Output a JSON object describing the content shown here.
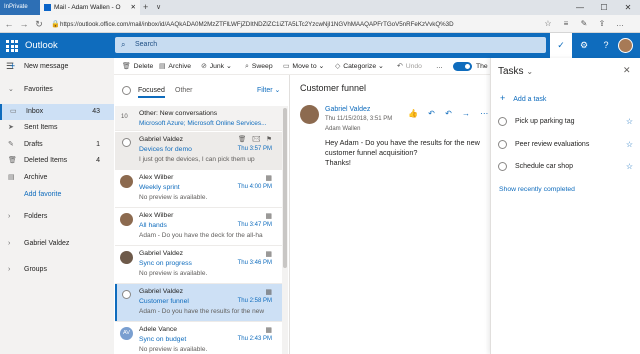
{
  "browser": {
    "inprivate_label": "InPrivate",
    "tab_title": "Mail - Adam Wallen - O",
    "tab_close": "✕",
    "new_tab": "+",
    "tab_chevron": "∨",
    "url": "https://outlook.office.com/mail/inbox/id/AAQkADA0M2MzZTFlLWFjZDItNDZlZC1iZTA5LTc2YzcwNjI1NGVhMAAQAPFrTGoV5nRFeKzVvkQ%3D",
    "back": "←",
    "forward": "→",
    "refresh": "↻",
    "lock": "🔒",
    "toolbar_icons": [
      "☆",
      "≡",
      "✎",
      "⇪",
      "…"
    ],
    "win_min": "—",
    "win_max": "☐",
    "win_close": "✕"
  },
  "header": {
    "brand": "Outlook",
    "search_placeholder": "Search",
    "search_icon": "⌕",
    "icons": {
      "tasks": "✓",
      "settings": "⚙",
      "help": "?"
    }
  },
  "leftnav": {
    "hamburger": "☰",
    "new_message": "New message",
    "favorites": "Favorites",
    "folders": [
      {
        "label": "Inbox",
        "count": "43",
        "icon": "▭"
      },
      {
        "label": "Sent Items",
        "count": "",
        "icon": "➤"
      },
      {
        "label": "Drafts",
        "count": "1",
        "icon": "✎"
      },
      {
        "label": "Deleted Items",
        "count": "4",
        "icon": "🗑"
      },
      {
        "label": "Archive",
        "count": "",
        "icon": "▤"
      }
    ],
    "add_favorite": "Add favorite",
    "sections": [
      "Folders",
      "Gabriel Valdez",
      "Groups"
    ],
    "chevron": "›",
    "chevron_down": "⌄"
  },
  "commandbar": {
    "delete": "Delete",
    "archive": "Archive",
    "junk": "Junk",
    "sweep": "Sweep",
    "move_to": "Move to",
    "categorize": "Categorize",
    "undo": "Undo",
    "more": "…",
    "toggle_label": "The",
    "icons": {
      "delete": "🗑",
      "archive": "▤",
      "junk": "⊘",
      "sweep": "⌕",
      "move": "▭",
      "categorize": "◇",
      "undo": "↶",
      "dropdown": "⌄"
    }
  },
  "messagelist": {
    "tabs": {
      "focused": "Focused",
      "other": "Other"
    },
    "filter": "Filter",
    "filter_icon": "⌄",
    "other_box": {
      "count": "10",
      "title": "Other: New conversations",
      "senders": "Microsoft Azure; Microsoft Online Services..."
    },
    "mails": [
      {
        "sender": "Gabriel Valdez",
        "subject": "Devices for demo",
        "time": "Thu 3:57 PM",
        "preview": "I just got the devices, I can pick them up",
        "actions": "🗑 ✉ ⚑"
      },
      {
        "sender": "Alex Wilber",
        "subject": "Weekly sprint",
        "time": "Thu 4:00 PM",
        "preview": "No preview is available.",
        "cal": "▦"
      },
      {
        "sender": "Alex Wilber",
        "subject": "All hands",
        "time": "Thu 3:47 PM",
        "preview": "Adam - Do you have the deck for the all-ha",
        "cal": "▦"
      },
      {
        "sender": "Gabriel Valdez",
        "subject": "Sync on progress",
        "time": "Thu 3:46 PM",
        "preview": "No preview is available.",
        "cal": "▦"
      },
      {
        "sender": "Gabriel Valdez",
        "subject": "Customer funnel",
        "time": "Thu 2:58 PM",
        "preview": "Adam - Do you have the results for the new",
        "cal": "▦"
      },
      {
        "sender": "Adele Vance",
        "subject": "Sync on budget",
        "time": "Thu 2:43 PM",
        "preview": "No preview is available.",
        "cal": "▦",
        "initials": "AV"
      }
    ]
  },
  "reading": {
    "title": "Customer funnel",
    "sender": "Gabriel Valdez",
    "date": "Thu 11/15/2018, 3:51 PM",
    "to": "Adam Wallen",
    "actions": "👍 ↶ ↶ → ⋯",
    "body_line1": "Hey Adam - Do you have the results for the new customer funnel acquisition?",
    "body_line2": "Thanks!"
  },
  "tasks": {
    "title": "Tasks",
    "title_chevron": "⌄",
    "close": "✕",
    "add_task": "Add a task",
    "add_icon": "+",
    "items": [
      "Pick up parking tag",
      "Peer review evaluations",
      "Schedule car shop"
    ],
    "star": "☆",
    "show_completed": "Show recently completed"
  }
}
